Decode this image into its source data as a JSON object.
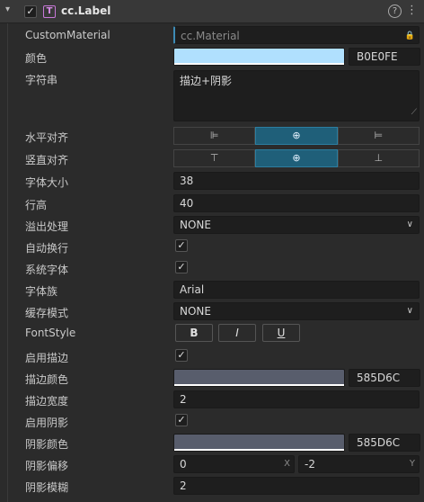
{
  "header": {
    "collapse_glyph": "▾",
    "enabled_glyph": "✓",
    "component_icon": "T",
    "title": "cc.Label",
    "help_glyph": "?",
    "menu_glyph": "⋮"
  },
  "props": {
    "custom_material": {
      "label": "CustomMaterial",
      "value": "cc.Material",
      "lock_glyph": "🔒"
    },
    "color": {
      "label": "颜色",
      "hex": "B0E0FE",
      "swatch": "#b0e0fe"
    },
    "string": {
      "label": "字符串",
      "value": "描边+阴影",
      "resize_glyph": "⟋"
    },
    "h_align": {
      "label": "水平对齐",
      "options": [
        "⊫",
        "⊕",
        "⊨"
      ],
      "selected_index": 1
    },
    "v_align": {
      "label": "竖直对齐",
      "options": [
        "⊤",
        "⊕",
        "⊥"
      ],
      "selected_index": 1
    },
    "font_size": {
      "label": "字体大小",
      "value": "38"
    },
    "line_height": {
      "label": "行高",
      "value": "40"
    },
    "overflow": {
      "label": "溢出处理",
      "value": "NONE",
      "chevron": "∨"
    },
    "wrap": {
      "label": "自动换行",
      "checked": "✓"
    },
    "system_font": {
      "label": "系统字体",
      "checked": "✓"
    },
    "font_family": {
      "label": "字体族",
      "value": "Arial"
    },
    "cache_mode": {
      "label": "缓存模式",
      "value": "NONE",
      "chevron": "∨"
    },
    "font_style": {
      "label": "FontStyle",
      "bold": "B",
      "italic": "I",
      "underline": "U"
    },
    "outline_enabled": {
      "label": "启用描边",
      "checked": "✓"
    },
    "outline_color": {
      "label": "描边颜色",
      "hex": "585D6C",
      "swatch": "#585d6c"
    },
    "outline_width": {
      "label": "描边宽度",
      "value": "2"
    },
    "shadow_enabled": {
      "label": "启用阴影",
      "checked": "✓"
    },
    "shadow_color": {
      "label": "阴影颜色",
      "hex": "585D6C",
      "swatch": "#585d6c"
    },
    "shadow_offset": {
      "label": "阴影偏移",
      "x": "0",
      "x_axis": "X",
      "y": "-2",
      "y_axis": "Y"
    },
    "shadow_blur": {
      "label": "阴影模糊",
      "value": "2"
    }
  }
}
